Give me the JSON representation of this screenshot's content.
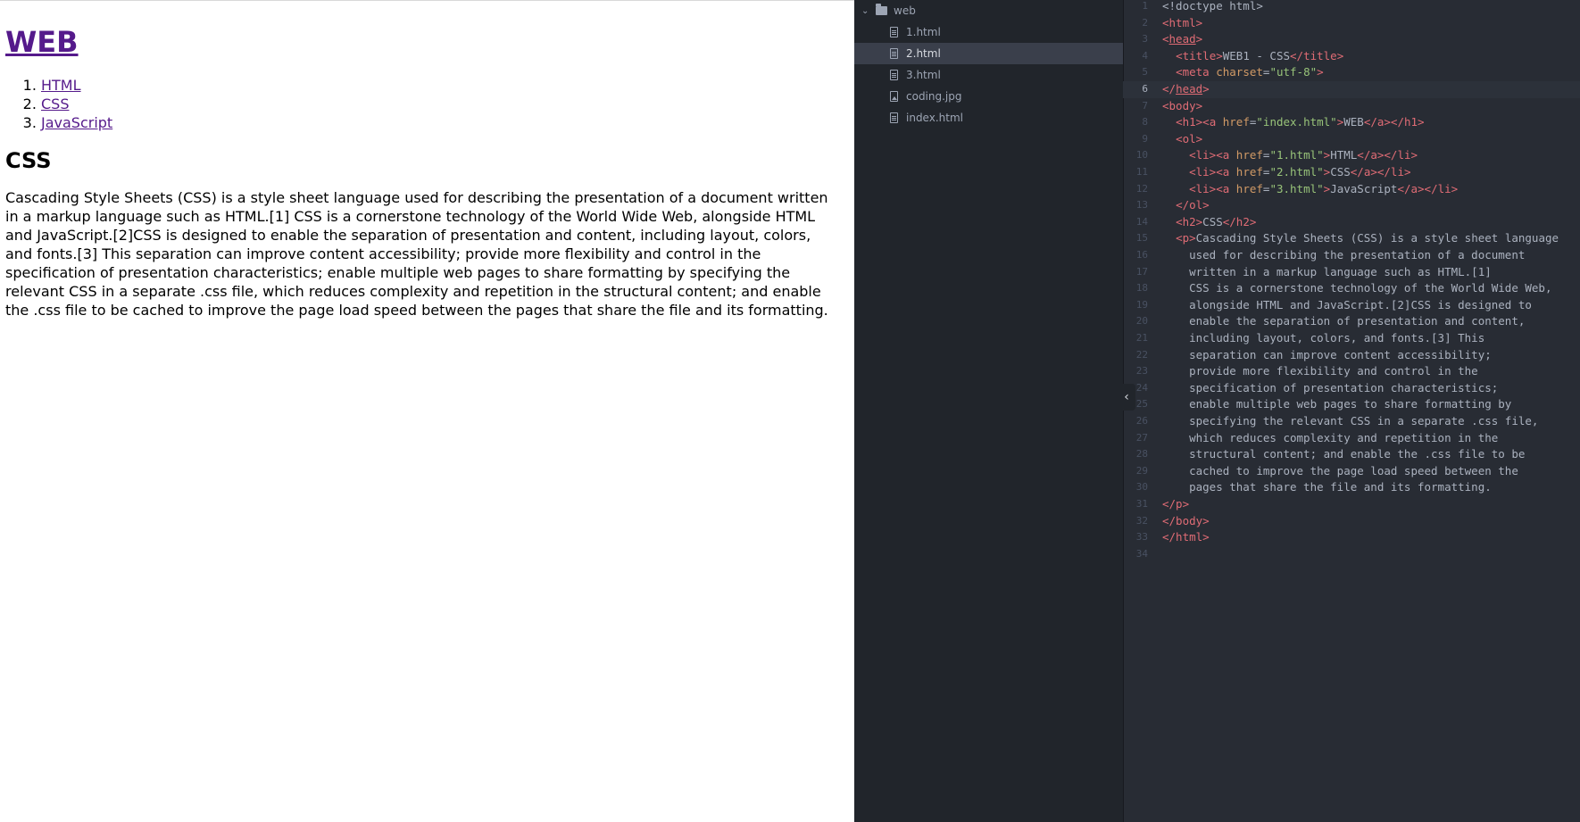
{
  "preview": {
    "title": "WEB",
    "list": [
      "HTML",
      "CSS",
      "JavaScript"
    ],
    "heading": "CSS",
    "paragraph": "Cascading Style Sheets (CSS) is a style sheet language used for describing the presentation of a document written in a markup language such as HTML.[1] CSS is a cornerstone technology of the World Wide Web, alongside HTML and JavaScript.[2]CSS is designed to enable the separation of presentation and content, including layout, colors, and fonts.[3] This separation can improve content accessibility; provide more flexibility and control in the specification of presentation characteristics; enable multiple web pages to share formatting by specifying the relevant CSS in a separate .css file, which reduces complexity and repetition in the structural content; and enable the .css file to be cached to improve the page load speed between the pages that share the file and its formatting."
  },
  "tree": {
    "folder": "web",
    "files": [
      {
        "name": "1.html",
        "type": "html"
      },
      {
        "name": "2.html",
        "type": "html",
        "selected": true
      },
      {
        "name": "3.html",
        "type": "html"
      },
      {
        "name": "coding.jpg",
        "type": "image"
      },
      {
        "name": "index.html",
        "type": "html"
      }
    ]
  },
  "editor": {
    "active_line": 6,
    "lines": [
      [
        [
          "tx",
          "<!doctype html>"
        ]
      ],
      [
        [
          "tg",
          "<html>"
        ]
      ],
      [
        [
          "tg",
          "<"
        ],
        [
          "tgu",
          "head"
        ],
        [
          "tg",
          ">"
        ]
      ],
      [
        [
          "tx",
          "  "
        ],
        [
          "tg",
          "<title>"
        ],
        [
          "tx",
          "WEB1 - CSS"
        ],
        [
          "tg",
          "</title>"
        ]
      ],
      [
        [
          "tx",
          "  "
        ],
        [
          "tg",
          "<meta "
        ],
        [
          "at",
          "charset"
        ],
        [
          "tx",
          "="
        ],
        [
          "st",
          "\"utf-8\""
        ],
        [
          "tg",
          ">"
        ]
      ],
      [
        [
          "tg",
          "</"
        ],
        [
          "tgu",
          "head"
        ],
        [
          "tg",
          ">"
        ]
      ],
      [
        [
          "tg",
          "<body>"
        ]
      ],
      [
        [
          "tx",
          "  "
        ],
        [
          "tg",
          "<h1><a "
        ],
        [
          "at",
          "href"
        ],
        [
          "tx",
          "="
        ],
        [
          "st",
          "\"index.html\""
        ],
        [
          "tg",
          ">"
        ],
        [
          "tx",
          "WEB"
        ],
        [
          "tg",
          "</a></h1>"
        ]
      ],
      [
        [
          "tx",
          "  "
        ],
        [
          "tg",
          "<ol>"
        ]
      ],
      [
        [
          "tx",
          "    "
        ],
        [
          "tg",
          "<li><a "
        ],
        [
          "at",
          "href"
        ],
        [
          "tx",
          "="
        ],
        [
          "st",
          "\"1.html\""
        ],
        [
          "tg",
          ">"
        ],
        [
          "tx",
          "HTML"
        ],
        [
          "tg",
          "</a></li>"
        ]
      ],
      [
        [
          "tx",
          "    "
        ],
        [
          "tg",
          "<li><a "
        ],
        [
          "at",
          "href"
        ],
        [
          "tx",
          "="
        ],
        [
          "st",
          "\"2.html\""
        ],
        [
          "tg",
          ">"
        ],
        [
          "tx",
          "CSS"
        ],
        [
          "tg",
          "</a></li>"
        ]
      ],
      [
        [
          "tx",
          "    "
        ],
        [
          "tg",
          "<li><a "
        ],
        [
          "at",
          "href"
        ],
        [
          "tx",
          "="
        ],
        [
          "st",
          "\"3.html\""
        ],
        [
          "tg",
          ">"
        ],
        [
          "tx",
          "JavaScript"
        ],
        [
          "tg",
          "</a></li>"
        ]
      ],
      [
        [
          "tx",
          "  "
        ],
        [
          "tg",
          "</ol>"
        ]
      ],
      [
        [
          "tx",
          "  "
        ],
        [
          "tg",
          "<h2>"
        ],
        [
          "tx",
          "CSS"
        ],
        [
          "tg",
          "</h2>"
        ]
      ],
      [
        [
          "tx",
          "  "
        ],
        [
          "tg",
          "<p>"
        ],
        [
          "tx",
          "Cascading Style Sheets (CSS) is a style sheet language"
        ]
      ],
      [
        [
          "tx",
          "    used for describing the presentation of a document"
        ]
      ],
      [
        [
          "tx",
          "    written in a markup language such as HTML.[1]"
        ]
      ],
      [
        [
          "tx",
          "    CSS is a cornerstone technology of the World Wide Web,"
        ]
      ],
      [
        [
          "tx",
          "    alongside HTML and JavaScript.[2]CSS is designed to"
        ]
      ],
      [
        [
          "tx",
          "    enable the separation of presentation and content,"
        ]
      ],
      [
        [
          "tx",
          "    including layout, colors, and fonts.[3] This"
        ]
      ],
      [
        [
          "tx",
          "    separation can improve content accessibility;"
        ]
      ],
      [
        [
          "tx",
          "    provide more flexibility and control in the"
        ]
      ],
      [
        [
          "tx",
          "    specification of presentation characteristics;"
        ]
      ],
      [
        [
          "tx",
          "    enable multiple web pages to share formatting by"
        ]
      ],
      [
        [
          "tx",
          "    specifying the relevant CSS in a separate .css file,"
        ]
      ],
      [
        [
          "tx",
          "    which reduces complexity and repetition in the"
        ]
      ],
      [
        [
          "tx",
          "    structural content; and enable the .css file to be"
        ]
      ],
      [
        [
          "tx",
          "    cached to improve the page load speed between the"
        ]
      ],
      [
        [
          "tx",
          "    pages that share the file and its formatting."
        ]
      ],
      [
        [
          "tg",
          "</p>"
        ]
      ],
      [
        [
          "tg",
          "</body>"
        ]
      ],
      [
        [
          "tg",
          "</html>"
        ]
      ],
      []
    ]
  },
  "collapse_glyph": "‹"
}
